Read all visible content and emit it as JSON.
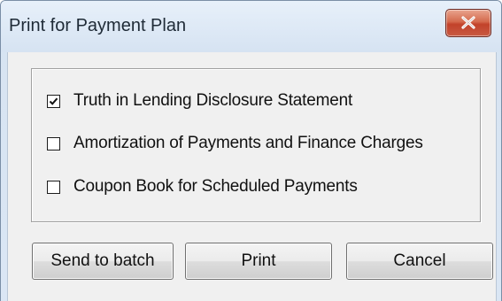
{
  "window": {
    "title": "Print for Payment Plan",
    "close_icon": "close-x-icon",
    "close_color": "#c7452d"
  },
  "options": [
    {
      "label": "Truth in Lending Disclosure Statement",
      "checked": true
    },
    {
      "label": "Amortization of Payments and Finance Charges",
      "checked": false
    },
    {
      "label": "Coupon Book for Scheduled Payments",
      "checked": false
    }
  ],
  "buttons": {
    "send_to_batch": "Send to batch",
    "print": "Print",
    "cancel": "Cancel"
  }
}
